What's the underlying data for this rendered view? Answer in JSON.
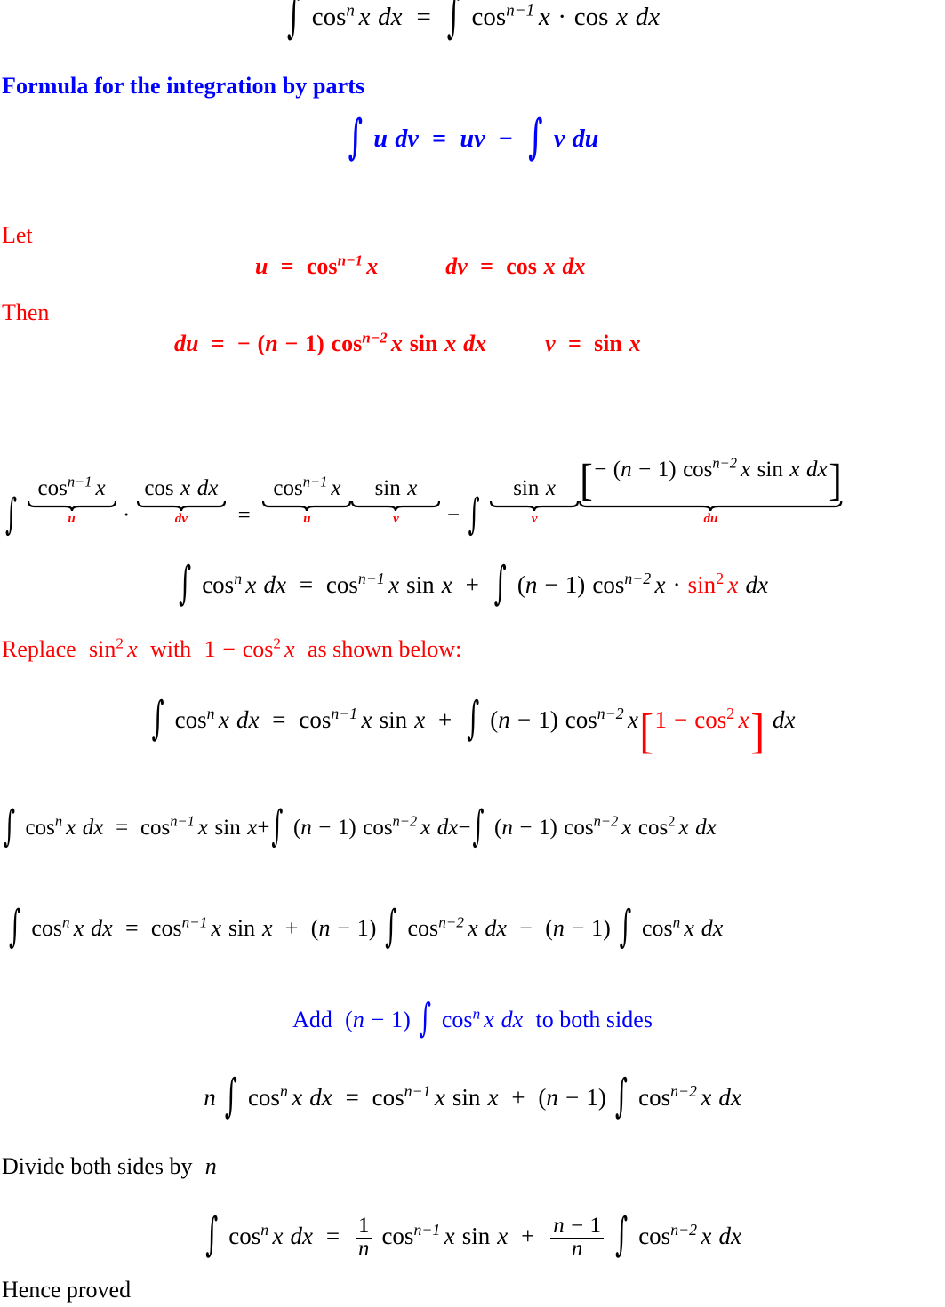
{
  "document": {
    "title": "Reduction formula proof for the integral of cos^n x",
    "colors": {
      "text": "#000000",
      "highlight_red": "#ff0000",
      "highlight_blue": "#0000ff",
      "background": "#ffffff"
    }
  },
  "lines": {
    "eq_start": {
      "latex": "\\int \\cos^n x\\, dx = \\int \\cos^{n-1} x \\cdot \\cos x\\, dx",
      "plain": "∫ cos^n x dx = ∫ cos^(n-1) x · cos x dx",
      "color": "#000000"
    },
    "heading_parts": {
      "text": "Formula for the integration by parts",
      "color": "#0000ff"
    },
    "eq_parts": {
      "latex": "\\int u\\, dv = uv - \\int v\\, du",
      "plain": "∫ u dv = uv − ∫ v du",
      "color": "#0000ff"
    },
    "label_let": {
      "text": "Let",
      "color": "#ff0000"
    },
    "eq_let": {
      "left": {
        "plain": "u = cos^(n-1) x"
      },
      "right": {
        "plain": "dv = cos x dx"
      },
      "color": "#ff0000"
    },
    "label_then": {
      "text": "Then",
      "color": "#ff0000"
    },
    "eq_then": {
      "left": {
        "plain": "du = − (n − 1) cos^(n-2) x sin x dx"
      },
      "right": {
        "plain": "v = sin x"
      },
      "color": "#ff0000"
    },
    "eq_underbrace": {
      "plain": "∫ cos^(n-1) x · cos x dx = cos^(n-1) x sin x − ∫ sin x [− (n − 1) cos^(n-2) x sin x dx]",
      "brace_labels": [
        "u",
        "dv",
        "u",
        "v",
        "v",
        "du"
      ],
      "label_color": "#ff0000"
    },
    "eq_after_parts": {
      "plain": "∫ cos^n x dx = cos^(n-1) x sin x + ∫ (n − 1) cos^(n-2) x · sin^2 x dx",
      "red_part": "sin^2 x"
    },
    "note_replace": {
      "text_plain": "Replace sin^2 x with 1 − cos^2 x as shown below:",
      "color": "#ff0000"
    },
    "eq_substituted": {
      "plain": "∫ cos^n x dx = cos^(n-1) x sin x + ∫ (n − 1) cos^(n-2) x [1 − cos^2 x] dx",
      "red_part": "[1 − cos^2 x]"
    },
    "eq_expanded": {
      "plain": "∫ cos^n x dx = cos^(n-1) x sin x + ∫ (n − 1) cos^(n-2) x dx − ∫ (n − 1) cos^(n-2) x cos^2 x dx"
    },
    "eq_collected": {
      "plain": "∫ cos^n x dx = cos^(n-1) x sin x + (n − 1) ∫ cos^(n-2) x dx − (n − 1) ∫ cos^n x dx"
    },
    "note_add": {
      "text_plain": "Add (n − 1) ∫ cos^n x dx to both sides",
      "color": "#0000ff"
    },
    "eq_combined": {
      "plain": "n ∫ cos^n x dx = cos^(n-1) x sin x + (n − 1) ∫ cos^(n-2) x dx"
    },
    "note_divide": {
      "text_plain": "Divide both sides by n",
      "color": "#000000"
    },
    "eq_final": {
      "plain": "∫ cos^n x dx = (1/n) cos^(n-1) x sin x + ((n − 1)/n) ∫ cos^(n-2) x dx"
    },
    "note_qed": {
      "text": "Hence proved",
      "color": "#000000"
    }
  },
  "symbols": {
    "integral": "∫",
    "cos": "cos",
    "sin": "sin",
    "minus": "−",
    "plus": "+",
    "equals": "=",
    "cdot": "·",
    "var_x": "x",
    "var_n": "n",
    "var_u": "u",
    "var_v": "v",
    "dx": "dx",
    "du": "du",
    "dv": "dv",
    "one": "1",
    "two": "2",
    "exp_n": "n",
    "exp_n_minus_1": "n−1",
    "exp_n_minus_2": "n−2"
  }
}
